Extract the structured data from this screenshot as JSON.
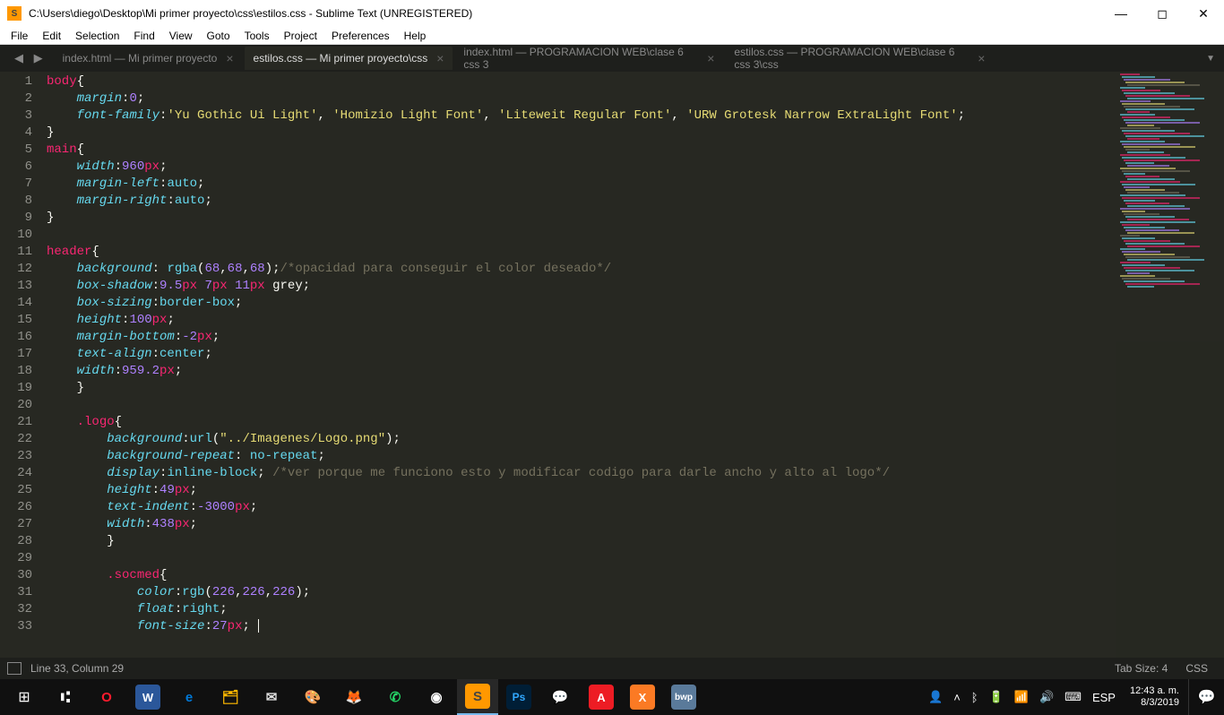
{
  "titlebar": {
    "path": "C:\\Users\\diego\\Desktop\\Mi primer proyecto\\css\\estilos.css - Sublime Text (UNREGISTERED)"
  },
  "menubar": {
    "items": [
      "File",
      "Edit",
      "Selection",
      "Find",
      "View",
      "Goto",
      "Tools",
      "Project",
      "Preferences",
      "Help"
    ]
  },
  "tabs": [
    {
      "label": "index.html — Mi primer proyecto",
      "active": false
    },
    {
      "label": "estilos.css — Mi primer proyecto\\css",
      "active": true
    },
    {
      "label": "index.html — PROGRAMACION  WEB\\clase 6 css 3",
      "active": false
    },
    {
      "label": "estilos.css — PROGRAMACION  WEB\\clase 6 css 3\\css",
      "active": false
    }
  ],
  "code_lines": [
    [
      {
        "t": "body",
        "c": "c-selector"
      },
      {
        "t": "{",
        "c": "c-plain"
      }
    ],
    [
      {
        "t": "    ",
        "c": ""
      },
      {
        "t": "margin",
        "c": "c-prop"
      },
      {
        "t": ":",
        "c": "c-plain"
      },
      {
        "t": "0",
        "c": "c-num"
      },
      {
        "t": ";",
        "c": "c-plain"
      }
    ],
    [
      {
        "t": "    ",
        "c": ""
      },
      {
        "t": "font-family",
        "c": "c-prop"
      },
      {
        "t": ":",
        "c": "c-plain"
      },
      {
        "t": "'Yu Gothic Ui Light'",
        "c": "c-str"
      },
      {
        "t": ", ",
        "c": "c-plain"
      },
      {
        "t": "'Homizio Light Font'",
        "c": "c-str"
      },
      {
        "t": ", ",
        "c": "c-plain"
      },
      {
        "t": "'Liteweit Regular Font'",
        "c": "c-str"
      },
      {
        "t": ", ",
        "c": "c-plain"
      },
      {
        "t": "'URW Grotesk Narrow ExtraLight Font'",
        "c": "c-str"
      },
      {
        "t": ";",
        "c": "c-plain"
      }
    ],
    [
      {
        "t": "}",
        "c": "c-plain"
      }
    ],
    [
      {
        "t": "main",
        "c": "c-selector"
      },
      {
        "t": "{",
        "c": "c-plain"
      }
    ],
    [
      {
        "t": "    ",
        "c": ""
      },
      {
        "t": "width",
        "c": "c-prop"
      },
      {
        "t": ":",
        "c": "c-plain"
      },
      {
        "t": "960",
        "c": "c-num"
      },
      {
        "t": "px",
        "c": "c-unit"
      },
      {
        "t": ";",
        "c": "c-plain"
      }
    ],
    [
      {
        "t": "    ",
        "c": ""
      },
      {
        "t": "margin-left",
        "c": "c-prop"
      },
      {
        "t": ":",
        "c": "c-plain"
      },
      {
        "t": "auto",
        "c": "c-fn"
      },
      {
        "t": ";",
        "c": "c-plain"
      }
    ],
    [
      {
        "t": "    ",
        "c": ""
      },
      {
        "t": "margin-right",
        "c": "c-prop"
      },
      {
        "t": ":",
        "c": "c-plain"
      },
      {
        "t": "auto",
        "c": "c-fn"
      },
      {
        "t": ";",
        "c": "c-plain"
      }
    ],
    [
      {
        "t": "}",
        "c": "c-plain"
      }
    ],
    [],
    [
      {
        "t": "header",
        "c": "c-selector"
      },
      {
        "t": "{",
        "c": "c-plain"
      }
    ],
    [
      {
        "t": "    ",
        "c": ""
      },
      {
        "t": "background",
        "c": "c-prop"
      },
      {
        "t": ": ",
        "c": "c-plain"
      },
      {
        "t": "rgba",
        "c": "c-fn"
      },
      {
        "t": "(",
        "c": "c-plain"
      },
      {
        "t": "68",
        "c": "c-num"
      },
      {
        "t": ",",
        "c": "c-plain"
      },
      {
        "t": "68",
        "c": "c-num"
      },
      {
        "t": ",",
        "c": "c-plain"
      },
      {
        "t": "68",
        "c": "c-num"
      },
      {
        "t": ");",
        "c": "c-plain"
      },
      {
        "t": "/*opacidad para conseguir el color deseado*/",
        "c": "c-comment"
      }
    ],
    [
      {
        "t": "    ",
        "c": ""
      },
      {
        "t": "box-shadow",
        "c": "c-prop"
      },
      {
        "t": ":",
        "c": "c-plain"
      },
      {
        "t": "9.5",
        "c": "c-num"
      },
      {
        "t": "px",
        "c": "c-unit"
      },
      {
        "t": " ",
        "c": ""
      },
      {
        "t": "7",
        "c": "c-num"
      },
      {
        "t": "px",
        "c": "c-unit"
      },
      {
        "t": " ",
        "c": ""
      },
      {
        "t": "11",
        "c": "c-num"
      },
      {
        "t": "px",
        "c": "c-unit"
      },
      {
        "t": " grey;",
        "c": "c-plain"
      }
    ],
    [
      {
        "t": "    ",
        "c": ""
      },
      {
        "t": "box-sizing",
        "c": "c-prop"
      },
      {
        "t": ":",
        "c": "c-plain"
      },
      {
        "t": "border-box",
        "c": "c-fn"
      },
      {
        "t": ";",
        "c": "c-plain"
      }
    ],
    [
      {
        "t": "    ",
        "c": ""
      },
      {
        "t": "height",
        "c": "c-prop"
      },
      {
        "t": ":",
        "c": "c-plain"
      },
      {
        "t": "100",
        "c": "c-num"
      },
      {
        "t": "px",
        "c": "c-unit"
      },
      {
        "t": ";",
        "c": "c-plain"
      }
    ],
    [
      {
        "t": "    ",
        "c": ""
      },
      {
        "t": "margin-bottom",
        "c": "c-prop"
      },
      {
        "t": ":",
        "c": "c-plain"
      },
      {
        "t": "-2",
        "c": "c-num"
      },
      {
        "t": "px",
        "c": "c-unit"
      },
      {
        "t": ";",
        "c": "c-plain"
      }
    ],
    [
      {
        "t": "    ",
        "c": ""
      },
      {
        "t": "text-align",
        "c": "c-prop"
      },
      {
        "t": ":",
        "c": "c-plain"
      },
      {
        "t": "center",
        "c": "c-fn"
      },
      {
        "t": ";",
        "c": "c-plain"
      }
    ],
    [
      {
        "t": "    ",
        "c": ""
      },
      {
        "t": "width",
        "c": "c-prop"
      },
      {
        "t": ":",
        "c": "c-plain"
      },
      {
        "t": "959.2",
        "c": "c-num"
      },
      {
        "t": "px",
        "c": "c-unit"
      },
      {
        "t": ";",
        "c": "c-plain"
      }
    ],
    [
      {
        "t": "    }",
        "c": "c-plain"
      }
    ],
    [],
    [
      {
        "t": "    ",
        "c": ""
      },
      {
        "t": ".logo",
        "c": "c-selector"
      },
      {
        "t": "{",
        "c": "c-plain"
      }
    ],
    [
      {
        "t": "        ",
        "c": ""
      },
      {
        "t": "background",
        "c": "c-prop"
      },
      {
        "t": ":",
        "c": "c-plain"
      },
      {
        "t": "url",
        "c": "c-fn"
      },
      {
        "t": "(",
        "c": "c-plain"
      },
      {
        "t": "\"../Imagenes/Logo.png\"",
        "c": "c-str"
      },
      {
        "t": ");",
        "c": "c-plain"
      }
    ],
    [
      {
        "t": "        ",
        "c": ""
      },
      {
        "t": "background-repeat",
        "c": "c-prop"
      },
      {
        "t": ": ",
        "c": "c-plain"
      },
      {
        "t": "no-repeat",
        "c": "c-fn"
      },
      {
        "t": ";",
        "c": "c-plain"
      }
    ],
    [
      {
        "t": "        ",
        "c": ""
      },
      {
        "t": "display",
        "c": "c-prop"
      },
      {
        "t": ":",
        "c": "c-plain"
      },
      {
        "t": "inline-block",
        "c": "c-fn"
      },
      {
        "t": "; ",
        "c": "c-plain"
      },
      {
        "t": "/*ver porque me funciono esto y modificar codigo para darle ancho y alto al logo*/",
        "c": "c-comment"
      }
    ],
    [
      {
        "t": "        ",
        "c": ""
      },
      {
        "t": "height",
        "c": "c-prop"
      },
      {
        "t": ":",
        "c": "c-plain"
      },
      {
        "t": "49",
        "c": "c-num"
      },
      {
        "t": "px",
        "c": "c-unit"
      },
      {
        "t": ";",
        "c": "c-plain"
      }
    ],
    [
      {
        "t": "        ",
        "c": ""
      },
      {
        "t": "text-indent",
        "c": "c-prop"
      },
      {
        "t": ":",
        "c": "c-plain"
      },
      {
        "t": "-3000",
        "c": "c-num"
      },
      {
        "t": "px",
        "c": "c-unit"
      },
      {
        "t": ";",
        "c": "c-plain"
      }
    ],
    [
      {
        "t": "        ",
        "c": ""
      },
      {
        "t": "width",
        "c": "c-prop"
      },
      {
        "t": ":",
        "c": "c-plain"
      },
      {
        "t": "438",
        "c": "c-num"
      },
      {
        "t": "px",
        "c": "c-unit"
      },
      {
        "t": ";",
        "c": "c-plain"
      }
    ],
    [
      {
        "t": "        }",
        "c": "c-plain"
      }
    ],
    [],
    [
      {
        "t": "        ",
        "c": ""
      },
      {
        "t": ".socmed",
        "c": "c-selector"
      },
      {
        "t": "{",
        "c": "c-plain"
      }
    ],
    [
      {
        "t": "            ",
        "c": ""
      },
      {
        "t": "color",
        "c": "c-prop"
      },
      {
        "t": ":",
        "c": "c-plain"
      },
      {
        "t": "rgb",
        "c": "c-fn"
      },
      {
        "t": "(",
        "c": "c-plain"
      },
      {
        "t": "226",
        "c": "c-num"
      },
      {
        "t": ",",
        "c": "c-plain"
      },
      {
        "t": "226",
        "c": "c-num"
      },
      {
        "t": ",",
        "c": "c-plain"
      },
      {
        "t": "226",
        "c": "c-num"
      },
      {
        "t": ");",
        "c": "c-plain"
      }
    ],
    [
      {
        "t": "            ",
        "c": ""
      },
      {
        "t": "float",
        "c": "c-prop"
      },
      {
        "t": ":",
        "c": "c-plain"
      },
      {
        "t": "right",
        "c": "c-fn"
      },
      {
        "t": ";",
        "c": "c-plain"
      }
    ],
    [
      {
        "t": "            ",
        "c": ""
      },
      {
        "t": "font-size",
        "c": "c-prop"
      },
      {
        "t": ":",
        "c": "c-plain"
      },
      {
        "t": "27",
        "c": "c-num"
      },
      {
        "t": "px",
        "c": "c-unit"
      },
      {
        "t": "; ",
        "c": "c-plain"
      },
      {
        "t": "",
        "c": "cursor-here"
      }
    ]
  ],
  "statusbar": {
    "position": "Line 33, Column 29",
    "tabsize": "Tab Size: 4",
    "syntax": "CSS"
  },
  "tray": {
    "lang": "ESP",
    "time": "12:43 a. m.",
    "date": "8/3/2019"
  }
}
